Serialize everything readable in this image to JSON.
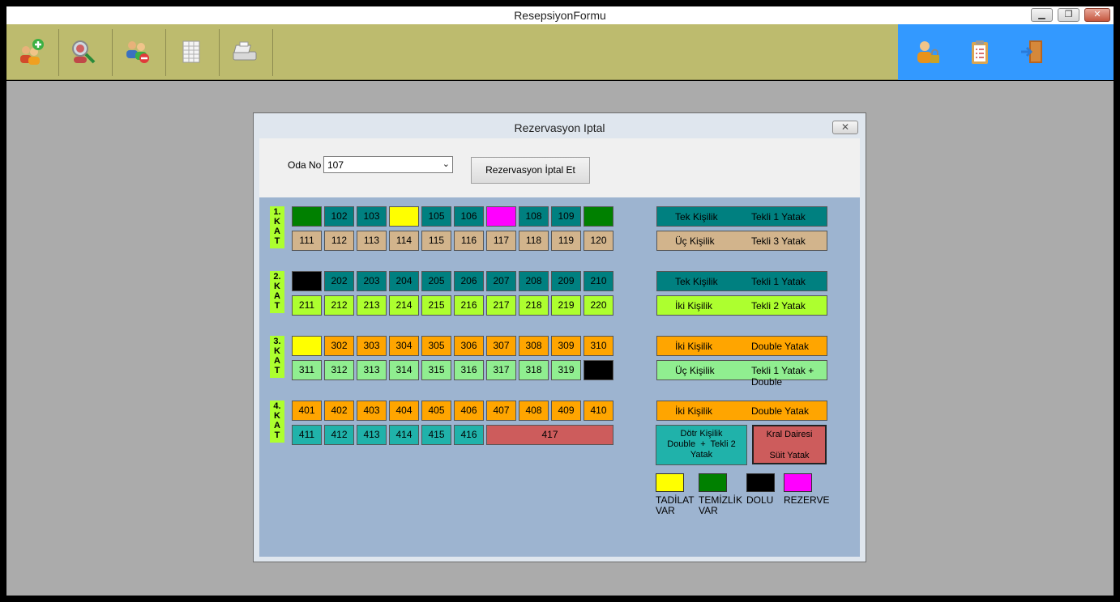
{
  "window": {
    "title": "ResepsiyonFormu",
    "minimize": "▁",
    "maximize": "❐",
    "close": "✕"
  },
  "toolbar": {
    "icons": [
      "add-user-icon",
      "search-user-icon",
      "remove-user-icon",
      "spreadsheet-icon",
      "cash-register-icon"
    ],
    "right_icons": [
      "user-lock-icon",
      "clipboard-icon",
      "exit-door-icon"
    ]
  },
  "dialog": {
    "title": "Rezervasyon Iptal",
    "close": "✕",
    "oda_label": "Oda No",
    "oda_value": "107",
    "cancel_button": "Rezervasyon İptal Et"
  },
  "floors": [
    {
      "label": "1.\nK\nA\nT",
      "rows": [
        [
          {
            "n": "",
            "c": "#008000"
          },
          {
            "n": "102",
            "c": "#008080"
          },
          {
            "n": "103",
            "c": "#008080"
          },
          {
            "n": "",
            "c": "#ffff00"
          },
          {
            "n": "105",
            "c": "#008080"
          },
          {
            "n": "106",
            "c": "#008080"
          },
          {
            "n": "",
            "c": "#ff00ff"
          },
          {
            "n": "108",
            "c": "#008080"
          },
          {
            "n": "109",
            "c": "#008080"
          },
          {
            "n": "",
            "c": "#008000"
          }
        ],
        [
          {
            "n": "111",
            "c": "#d2b48c"
          },
          {
            "n": "112",
            "c": "#d2b48c"
          },
          {
            "n": "113",
            "c": "#d2b48c"
          },
          {
            "n": "114",
            "c": "#d2b48c"
          },
          {
            "n": "115",
            "c": "#d2b48c"
          },
          {
            "n": "116",
            "c": "#d2b48c"
          },
          {
            "n": "117",
            "c": "#d2b48c"
          },
          {
            "n": "118",
            "c": "#d2b48c"
          },
          {
            "n": "119",
            "c": "#d2b48c"
          },
          {
            "n": "120",
            "c": "#d2b48c"
          }
        ]
      ],
      "legend": [
        {
          "a": "Tek Kişilik",
          "b": "Tekli 1 Yatak",
          "c": "#008080"
        },
        {
          "a": "Üç Kişilik",
          "b": "Tekli 3 Yatak",
          "c": "#d2b48c"
        }
      ]
    },
    {
      "label": "2.\nK\nA\nT",
      "rows": [
        [
          {
            "n": "",
            "c": "#000000"
          },
          {
            "n": "202",
            "c": "#008080"
          },
          {
            "n": "203",
            "c": "#008080"
          },
          {
            "n": "204",
            "c": "#008080"
          },
          {
            "n": "205",
            "c": "#008080"
          },
          {
            "n": "206",
            "c": "#008080"
          },
          {
            "n": "207",
            "c": "#008080"
          },
          {
            "n": "208",
            "c": "#008080"
          },
          {
            "n": "209",
            "c": "#008080"
          },
          {
            "n": "210",
            "c": "#008080"
          }
        ],
        [
          {
            "n": "211",
            "c": "#adff2f"
          },
          {
            "n": "212",
            "c": "#adff2f"
          },
          {
            "n": "213",
            "c": "#adff2f"
          },
          {
            "n": "214",
            "c": "#adff2f"
          },
          {
            "n": "215",
            "c": "#adff2f"
          },
          {
            "n": "216",
            "c": "#adff2f"
          },
          {
            "n": "217",
            "c": "#adff2f"
          },
          {
            "n": "218",
            "c": "#adff2f"
          },
          {
            "n": "219",
            "c": "#adff2f"
          },
          {
            "n": "220",
            "c": "#adff2f"
          }
        ]
      ],
      "legend": [
        {
          "a": "Tek Kişilik",
          "b": "Tekli 1 Yatak",
          "c": "#008080"
        },
        {
          "a": "İki Kişilik",
          "b": "Tekli 2 Yatak",
          "c": "#adff2f"
        }
      ]
    },
    {
      "label": "3.\nK\nA\nT",
      "rows": [
        [
          {
            "n": "",
            "c": "#ffff00"
          },
          {
            "n": "302",
            "c": "#ffa500"
          },
          {
            "n": "303",
            "c": "#ffa500"
          },
          {
            "n": "304",
            "c": "#ffa500"
          },
          {
            "n": "305",
            "c": "#ffa500"
          },
          {
            "n": "306",
            "c": "#ffa500"
          },
          {
            "n": "307",
            "c": "#ffa500"
          },
          {
            "n": "308",
            "c": "#ffa500"
          },
          {
            "n": "309",
            "c": "#ffa500"
          },
          {
            "n": "310",
            "c": "#ffa500"
          }
        ],
        [
          {
            "n": "311",
            "c": "#90ee90"
          },
          {
            "n": "312",
            "c": "#90ee90"
          },
          {
            "n": "313",
            "c": "#90ee90"
          },
          {
            "n": "314",
            "c": "#90ee90"
          },
          {
            "n": "315",
            "c": "#90ee90"
          },
          {
            "n": "316",
            "c": "#90ee90"
          },
          {
            "n": "317",
            "c": "#90ee90"
          },
          {
            "n": "318",
            "c": "#90ee90"
          },
          {
            "n": "319",
            "c": "#90ee90"
          },
          {
            "n": "",
            "c": "#000000"
          }
        ]
      ],
      "legend": [
        {
          "a": "İki  Kişilik",
          "b": "Double Yatak",
          "c": "#ffa500"
        },
        {
          "a": "Üç Kişilik",
          "b": "Tekli 1 Yatak + Double",
          "c": "#90ee90"
        }
      ]
    },
    {
      "label": "4.\nK\nA\nT",
      "rows": [
        [
          {
            "n": "401",
            "c": "#ffa500"
          },
          {
            "n": "402",
            "c": "#ffa500"
          },
          {
            "n": "403",
            "c": "#ffa500"
          },
          {
            "n": "404",
            "c": "#ffa500"
          },
          {
            "n": "405",
            "c": "#ffa500"
          },
          {
            "n": "406",
            "c": "#ffa500"
          },
          {
            "n": "407",
            "c": "#ffa500"
          },
          {
            "n": "408",
            "c": "#ffa500"
          },
          {
            "n": "409",
            "c": "#ffa500"
          },
          {
            "n": "410",
            "c": "#ffa500"
          }
        ],
        [
          {
            "n": "411",
            "c": "#20b2aa"
          },
          {
            "n": "412",
            "c": "#20b2aa"
          },
          {
            "n": "413",
            "c": "#20b2aa"
          },
          {
            "n": "414",
            "c": "#20b2aa"
          },
          {
            "n": "415",
            "c": "#20b2aa"
          },
          {
            "n": "416",
            "c": "#20b2aa"
          },
          {
            "n": "417",
            "c": "#cd5c5c",
            "wide": true
          }
        ]
      ],
      "legend": [
        {
          "a": "İki  Kişilik",
          "b": "Double Yatak",
          "c": "#ffa500"
        }
      ],
      "legend_extra": [
        {
          "text": "Dötr Kişilik\nDouble  +  Tekli 2\nYatak",
          "c": "#20b2aa"
        },
        {
          "text": "Kral Dairesi\n\nSüit Yatak",
          "c": "#cd5c5c"
        }
      ]
    }
  ],
  "status_keys": [
    {
      "label": "TADİLAT\nVAR",
      "c": "#ffff00"
    },
    {
      "label": "TEMİZLİK\nVAR",
      "c": "#008000"
    },
    {
      "label": "DOLU",
      "c": "#000000"
    },
    {
      "label": "REZERVE",
      "c": "#ff00ff"
    }
  ]
}
